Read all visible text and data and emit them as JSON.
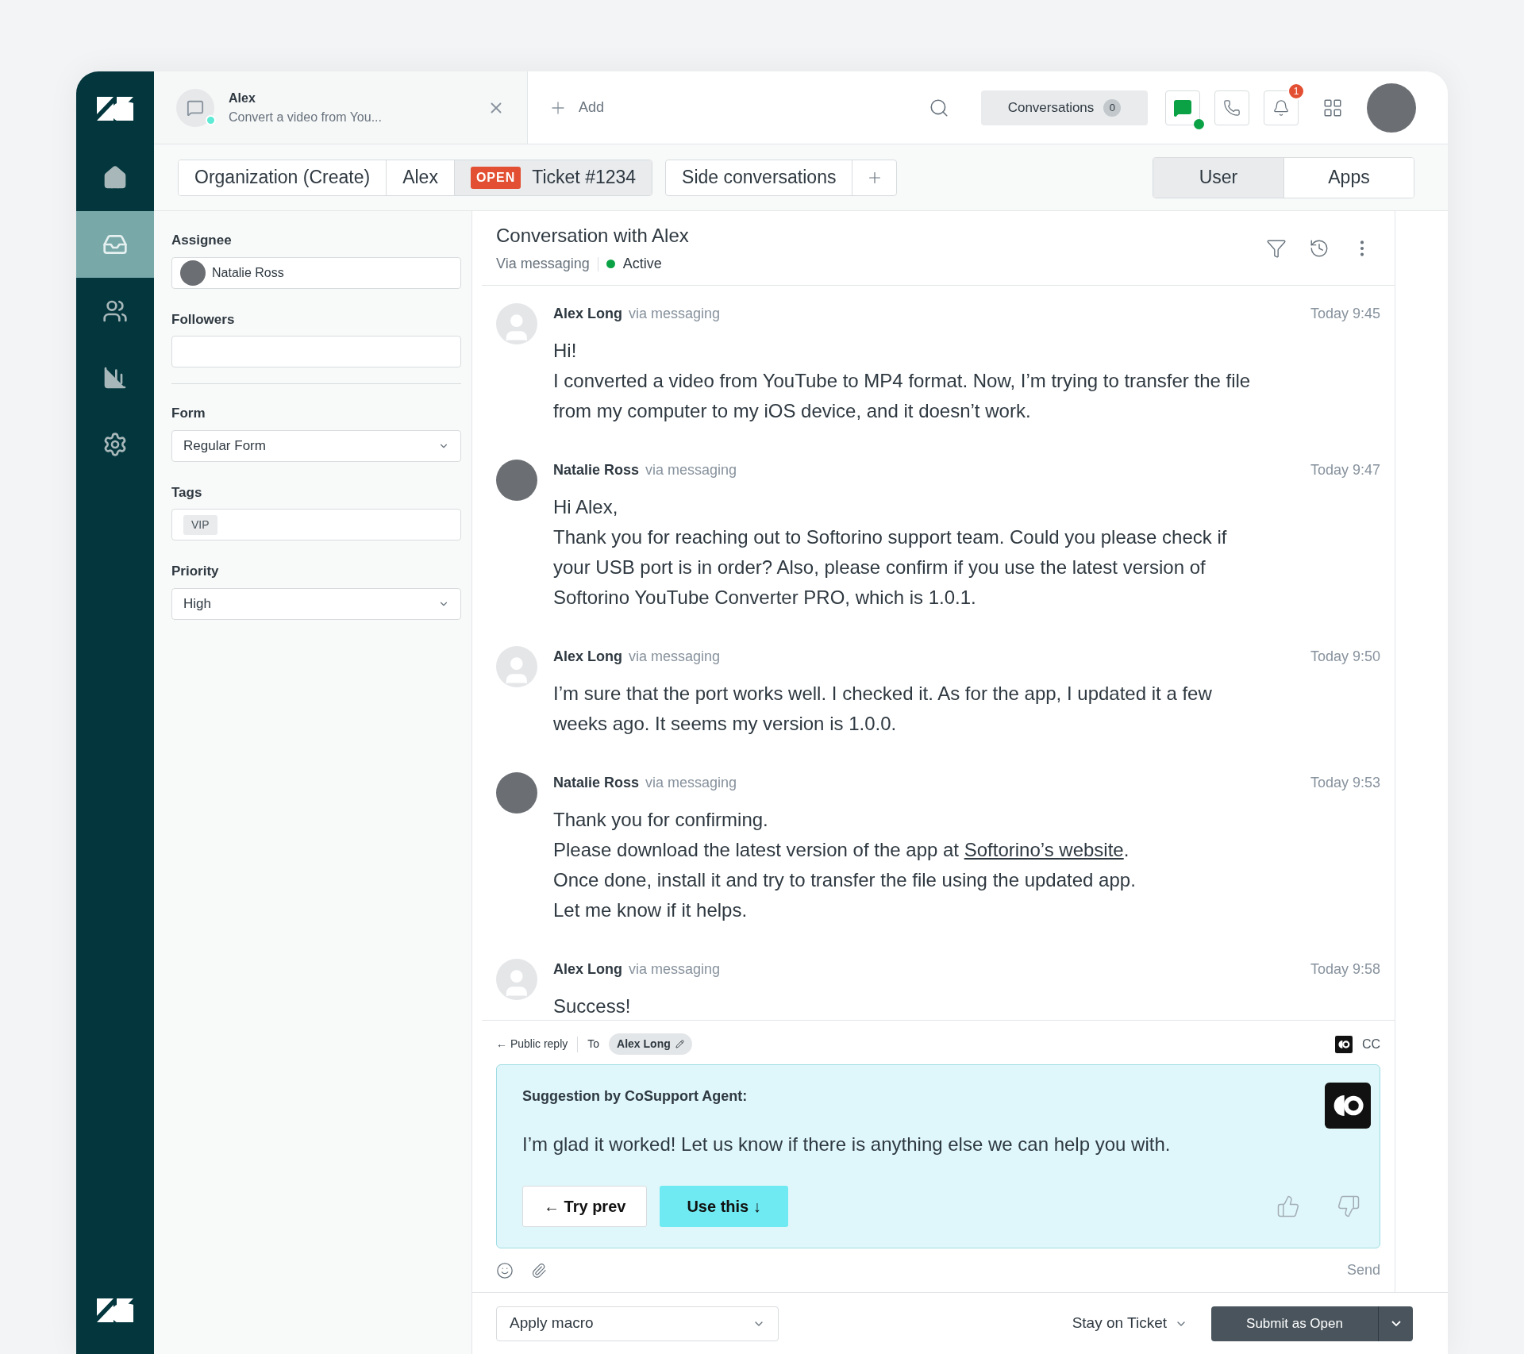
{
  "sidebar": {
    "items": [
      {
        "selected": false
      },
      {
        "selected": true
      },
      {
        "selected": false
      },
      {
        "selected": false
      },
      {
        "selected": false
      }
    ]
  },
  "top_bar": {
    "open_tab": {
      "title": "Alex",
      "subtitle": "Convert a video from You..."
    },
    "add": "Add",
    "conversations": {
      "label": "Conversations",
      "count": "0"
    },
    "notification_count": "1"
  },
  "ticket_tabs": [
    {
      "label": "Organization (Create)",
      "selected": false
    },
    {
      "label": "Alex",
      "selected": false
    },
    {
      "label": "Ticket #1234",
      "status": "OPEN",
      "selected": true
    }
  ],
  "side_conversations": "Side conversations",
  "panel_tabs": [
    {
      "label": "User",
      "selected": true
    },
    {
      "label": "Apps",
      "selected": false
    }
  ],
  "fields": [
    {
      "kind": "person",
      "label": "Assignee",
      "value": "Natalie Ross"
    },
    {
      "kind": "text",
      "label": "Followers"
    },
    {
      "kind": "select",
      "label": "Form",
      "value": "Regular Form"
    },
    {
      "kind": "tags",
      "label": "Tags",
      "tags": [
        "VIP"
      ]
    },
    {
      "kind": "select",
      "label": "Priority",
      "value": "High"
    }
  ],
  "conversation": {
    "title": "Conversation with Alex",
    "channel": "Via messaging",
    "status": "Active",
    "messages": [
      {
        "kind": "customer",
        "author": "Alex Long",
        "via": "via messaging",
        "time": "Today 9:45",
        "paragraphs": [
          {
            "text": "Hi!"
          },
          {
            "text": "I converted a video from YouTube to MP4 format. Now, I’m trying to transfer the file from my computer to my iOS device, and it doesn’t work."
          }
        ]
      },
      {
        "kind": "agent",
        "author": "Natalie Ross",
        "via": "via messaging",
        "time": "Today 9:47",
        "paragraphs": [
          {
            "text": "Hi Alex,"
          },
          {
            "text": "Thank you for reaching out to Softorino support team. Could you please check if your USB port is in order? Also, please confirm if you use the latest version of Softorino YouTube Converter PRO, which is 1.0.1."
          }
        ]
      },
      {
        "kind": "customer",
        "author": "Alex Long",
        "via": "via messaging",
        "time": "Today 9:50",
        "paragraphs": [
          {
            "text": "I’m sure that the port works well. I checked it. As for the app, I updated it a few weeks ago. It seems my version is 1.0.0."
          }
        ]
      },
      {
        "kind": "agent",
        "author": "Natalie Ross",
        "via": "via messaging",
        "time": "Today 9:53",
        "paragraphs": [
          {
            "text": "Thank you for confirming."
          },
          {
            "text": "Please download the latest version of the app at ",
            "link": "Softorino’s website",
            "after": "."
          },
          {
            "text": "Once done, install it and try to transfer the file using the updated app."
          },
          {
            "text": "Let me know if it helps."
          }
        ]
      },
      {
        "kind": "customer",
        "author": "Alex Long",
        "via": "via messaging",
        "time": "Today 9:58",
        "paragraphs": [
          {
            "text": "Success!"
          }
        ]
      }
    ]
  },
  "composer": {
    "mode": "← Public reply",
    "to_label": "To",
    "recipient": "Alex Long",
    "cc": "CC",
    "suggestion": {
      "title": "Suggestion by CoSupport Agent:",
      "text": "I’m glad it worked! Let us know if there is anything else we can help you with.",
      "prev": "← Try prev",
      "use": "Use this ↓"
    },
    "send": "Send"
  },
  "footer": {
    "macro": "Apply macro",
    "stay": "Stay on Ticket",
    "submit": "Submit as Open"
  }
}
